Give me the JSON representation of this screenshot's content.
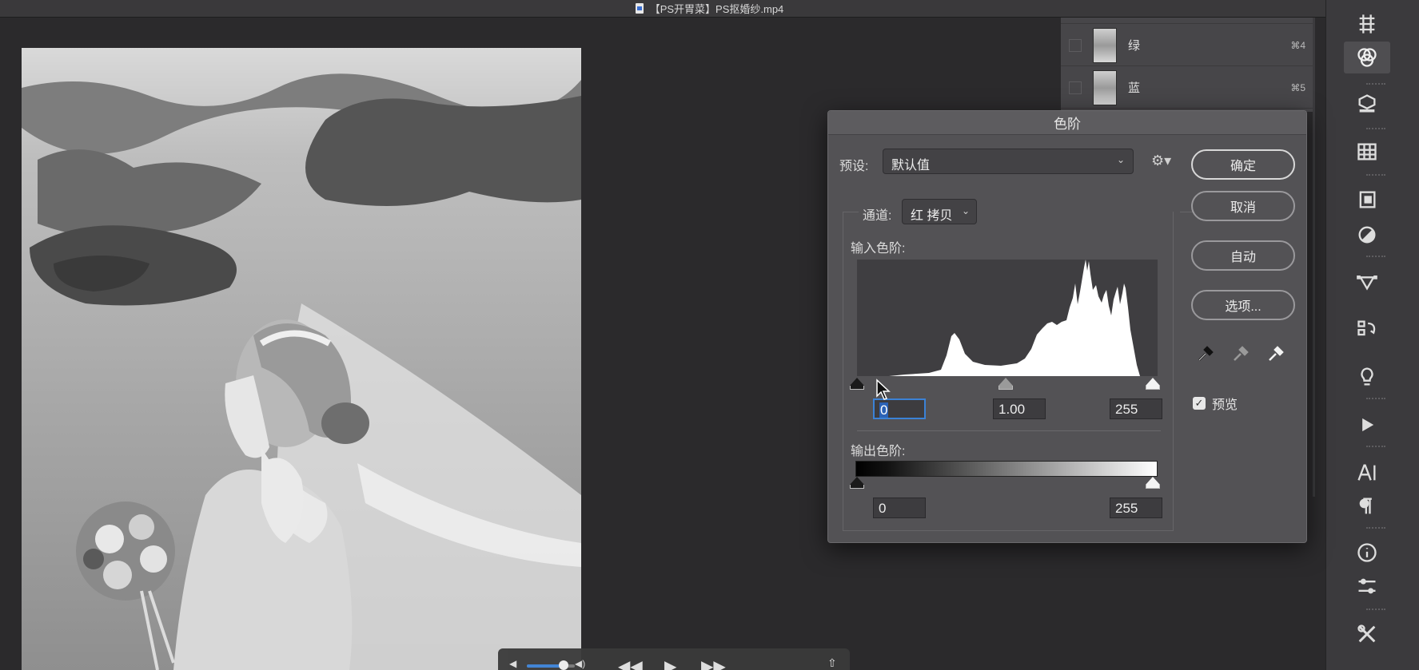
{
  "window": {
    "title": "【PS开胃菜】PS抠婚纱.mp4"
  },
  "channels": [
    {
      "name": "绿",
      "shortcut": "⌘4"
    },
    {
      "name": "蓝",
      "shortcut": "⌘5"
    }
  ],
  "dialog": {
    "title": "色阶",
    "preset_label": "预设:",
    "preset_value": "默认值",
    "channel_label": "通道:",
    "channel_value": "红 拷贝",
    "input_levels_label": "输入色阶:",
    "output_levels_label": "输出色阶:",
    "input_black": "0",
    "input_gamma": "1.00",
    "input_white": "255",
    "output_black": "0",
    "output_white": "255",
    "buttons": {
      "ok": "确定",
      "cancel": "取消",
      "auto": "自动",
      "options": "选项..."
    },
    "preview_label": "预览",
    "preview_checked": true
  },
  "toolbar_icons": [
    "grid-icon",
    "channels-icon",
    "3d-icon",
    "table-icon",
    "layer-comp-icon",
    "adjustments-icon",
    "paths-icon",
    "history-icon",
    "lightbulb-icon",
    "play-icon",
    "character-icon",
    "paragraph-icon",
    "info-icon",
    "properties-icon",
    "tools-icon"
  ],
  "colors": {
    "accent": "#3b82d6",
    "dialog_bg": "#535255",
    "canvas_bg": "#2b2a2c"
  }
}
